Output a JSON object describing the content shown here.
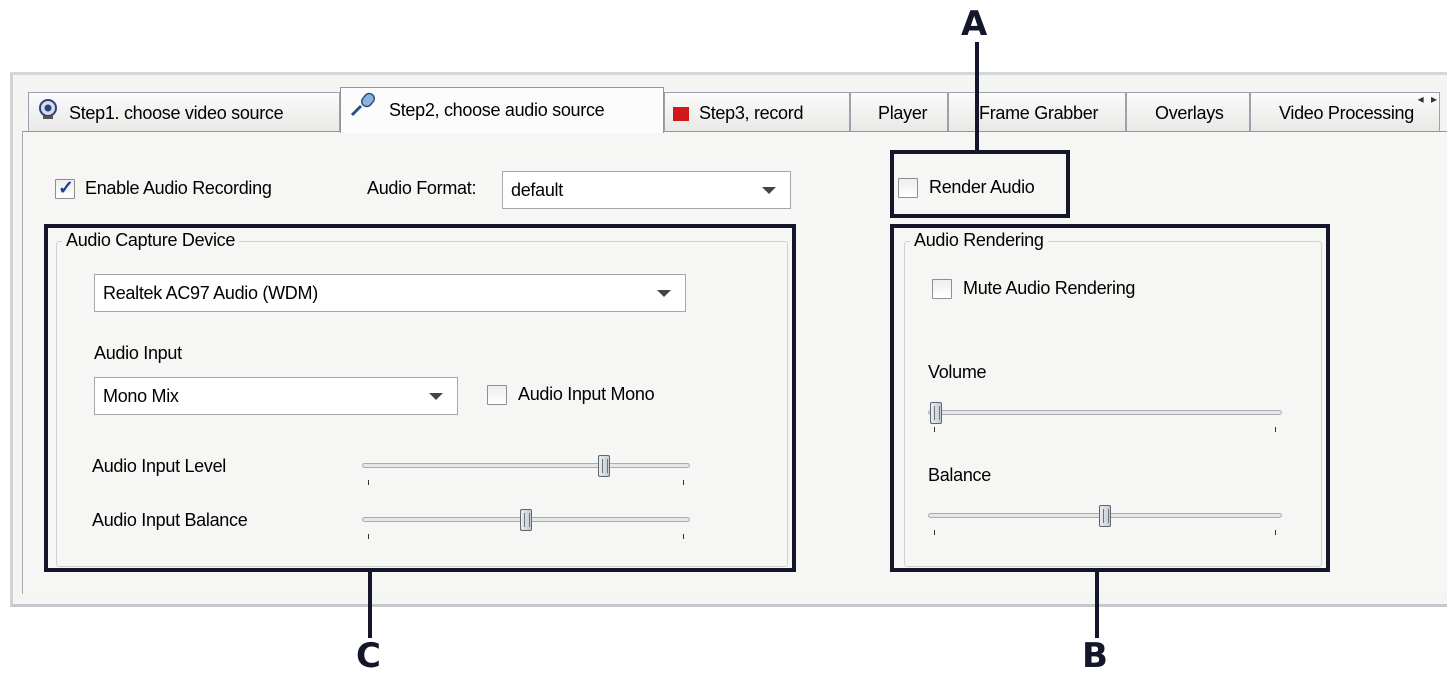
{
  "tabs": [
    {
      "label": "Step1. choose video source",
      "icon": "webcam-icon"
    },
    {
      "label": "Step2, choose audio source",
      "icon": "microphone-icon",
      "active": true
    },
    {
      "label": "Step3, record",
      "icon": "record-icon"
    },
    {
      "label": "Player"
    },
    {
      "label": "Frame Grabber"
    },
    {
      "label": "Overlays"
    },
    {
      "label": "Video Processing"
    }
  ],
  "tab_scroll": "◂ ▸",
  "top_row": {
    "enable_audio_recording": {
      "label": "Enable Audio Recording",
      "checked": true
    },
    "audio_format_label": "Audio Format:",
    "audio_format_value": "default",
    "render_audio": {
      "label": "Render Audio",
      "checked": false
    }
  },
  "capture": {
    "title": "Audio Capture Device",
    "device_value": "Realtek AC97 Audio (WDM)",
    "input_label": "Audio Input",
    "input_value": "Mono Mix",
    "input_mono": {
      "label": "Audio Input Mono",
      "checked": false
    },
    "level_label": "Audio Input Level",
    "level_value": 0.75,
    "balance_label": "Audio Input Balance",
    "balance_value": 0.5
  },
  "rendering": {
    "title": "Audio Rendering",
    "mute": {
      "label": "Mute Audio Rendering",
      "checked": false
    },
    "volume_label": "Volume",
    "volume_value": 0.0,
    "balance_label": "Balance",
    "balance_value": 0.5
  },
  "annotations": {
    "a": "A",
    "b": "B",
    "c": "C"
  },
  "colors": {
    "annotation": "#14162a",
    "checkmark": "#1f3f8f",
    "record": "#d01818"
  }
}
